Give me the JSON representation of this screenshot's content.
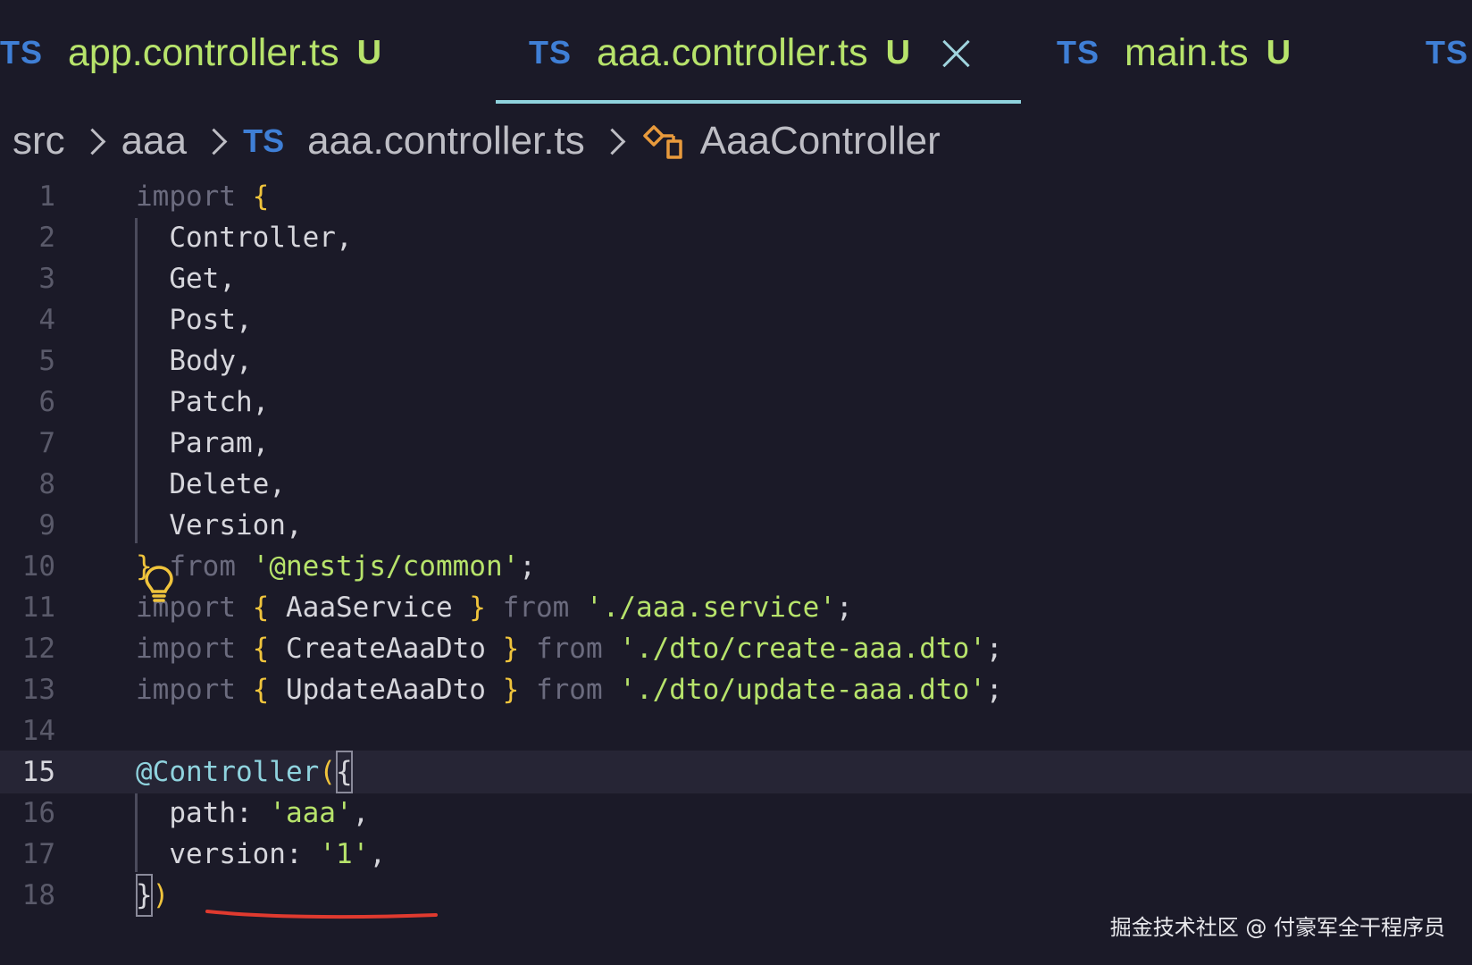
{
  "tabs": [
    {
      "icon": "TS",
      "name": "app.controller.ts",
      "status": "U",
      "active": false
    },
    {
      "icon": "TS",
      "name": "aaa.controller.ts",
      "status": "U",
      "active": true
    },
    {
      "icon": "TS",
      "name": "main.ts",
      "status": "U",
      "active": false
    },
    {
      "icon": "TS",
      "name": "",
      "status": "",
      "active": false
    }
  ],
  "breadcrumb": {
    "segments": [
      "src",
      "aaa"
    ],
    "file_icon": "TS",
    "file": "aaa.controller.ts",
    "symbol_icon": "class-icon",
    "symbol": "AaaController"
  },
  "editor": {
    "current_line": 15,
    "lines": [
      {
        "n": "1",
        "parts": [
          [
            "kw",
            "import"
          ],
          [
            "punct",
            " "
          ],
          [
            "br",
            "{"
          ]
        ]
      },
      {
        "n": "2",
        "parts": [
          [
            "punct",
            "  Controller,"
          ]
        ]
      },
      {
        "n": "3",
        "parts": [
          [
            "punct",
            "  Get,"
          ]
        ]
      },
      {
        "n": "4",
        "parts": [
          [
            "punct",
            "  Post,"
          ]
        ]
      },
      {
        "n": "5",
        "parts": [
          [
            "punct",
            "  Body,"
          ]
        ]
      },
      {
        "n": "6",
        "parts": [
          [
            "punct",
            "  Patch,"
          ]
        ]
      },
      {
        "n": "7",
        "parts": [
          [
            "punct",
            "  Param,"
          ]
        ]
      },
      {
        "n": "8",
        "parts": [
          [
            "punct",
            "  Delete,"
          ]
        ]
      },
      {
        "n": "9",
        "parts": [
          [
            "punct",
            "  Version,"
          ]
        ]
      },
      {
        "n": "10",
        "parts": [
          [
            "br",
            "}"
          ],
          [
            "punct",
            " "
          ],
          [
            "kw",
            "from"
          ],
          [
            "punct",
            " "
          ],
          [
            "str",
            "'@nestjs/common'"
          ],
          [
            "punct",
            ";"
          ]
        ]
      },
      {
        "n": "11",
        "parts": [
          [
            "kw",
            "import"
          ],
          [
            "punct",
            " "
          ],
          [
            "br",
            "{"
          ],
          [
            "punct",
            " AaaService "
          ],
          [
            "br",
            "}"
          ],
          [
            "punct",
            " "
          ],
          [
            "kw",
            "from"
          ],
          [
            "punct",
            " "
          ],
          [
            "str",
            "'./aaa.service'"
          ],
          [
            "punct",
            ";"
          ]
        ]
      },
      {
        "n": "12",
        "parts": [
          [
            "kw",
            "import"
          ],
          [
            "punct",
            " "
          ],
          [
            "br",
            "{"
          ],
          [
            "punct",
            " CreateAaaDto "
          ],
          [
            "br",
            "}"
          ],
          [
            "punct",
            " "
          ],
          [
            "kw",
            "from"
          ],
          [
            "punct",
            " "
          ],
          [
            "str",
            "'./dto/create-aaa.dto'"
          ],
          [
            "punct",
            ";"
          ]
        ]
      },
      {
        "n": "13",
        "parts": [
          [
            "kw",
            "import"
          ],
          [
            "punct",
            " "
          ],
          [
            "br",
            "{"
          ],
          [
            "punct",
            " UpdateAaaDto "
          ],
          [
            "br",
            "}"
          ],
          [
            "punct",
            " "
          ],
          [
            "kw",
            "from"
          ],
          [
            "punct",
            " "
          ],
          [
            "str",
            "'./dto/update-aaa.dto'"
          ],
          [
            "punct",
            ";"
          ]
        ]
      },
      {
        "n": "14",
        "parts": []
      },
      {
        "n": "15",
        "parts": [
          [
            "dec",
            "@Controller"
          ],
          [
            "br",
            "("
          ],
          [
            "box",
            "{"
          ]
        ]
      },
      {
        "n": "16",
        "parts": [
          [
            "punct",
            "  path: "
          ],
          [
            "str",
            "'aaa'"
          ],
          [
            "punct",
            ","
          ]
        ]
      },
      {
        "n": "17",
        "parts": [
          [
            "punct",
            "  version: "
          ],
          [
            "str",
            "'1'"
          ],
          [
            "punct",
            ","
          ]
        ]
      },
      {
        "n": "18",
        "parts": [
          [
            "box",
            "}"
          ],
          [
            "br",
            ")"
          ]
        ]
      }
    ]
  },
  "lightbulb_icon": "lightbulb-icon",
  "watermark": "掘金技术社区 @ 付豪军全干程序员",
  "colors": {
    "background": "#1b1a28",
    "ts_icon": "#3f7fd6",
    "modified_green": "#b7e36b",
    "active_underline": "#8fd3de",
    "keyword": "#6b6b7e",
    "bracket": "#f0c43c",
    "string": "#b7e36b",
    "squiggle": "#e03a2f"
  }
}
